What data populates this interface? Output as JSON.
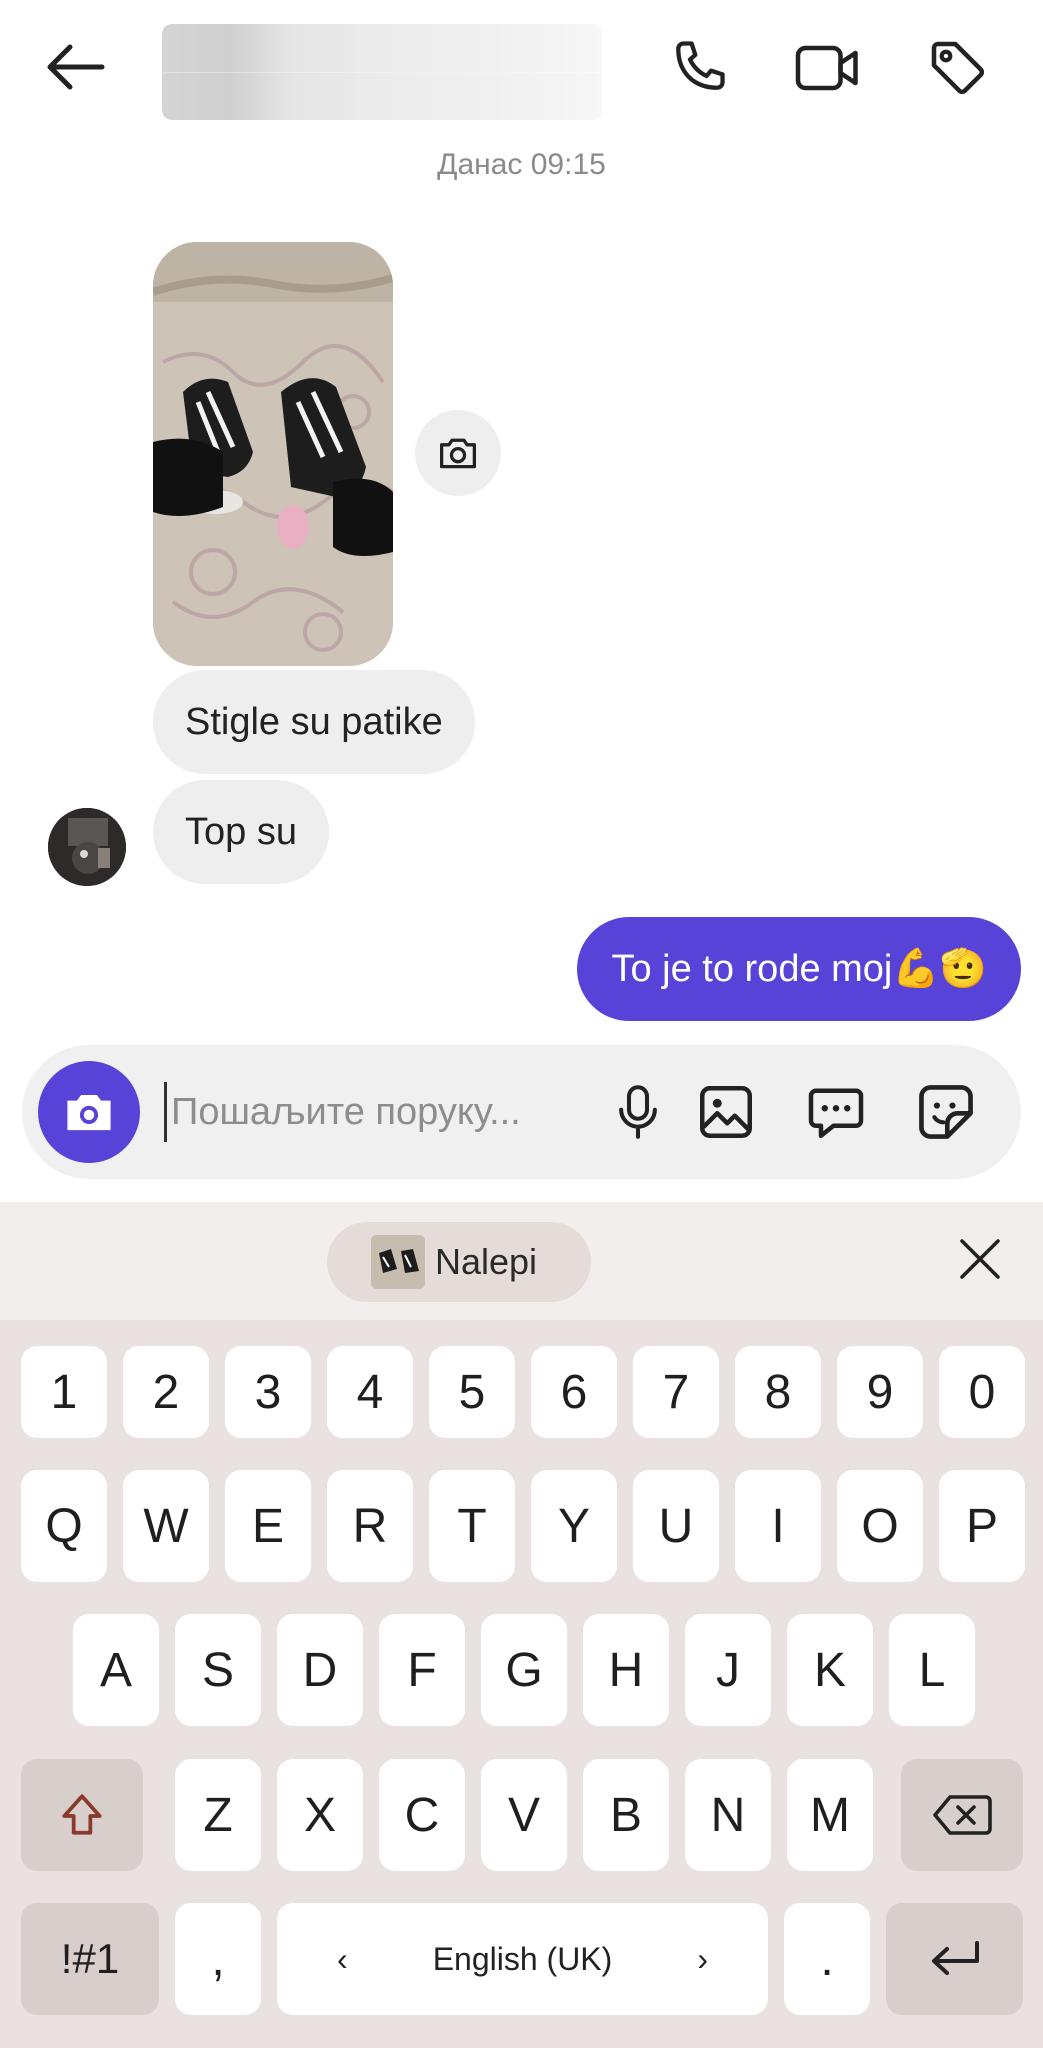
{
  "header": {
    "contact_name": "",
    "icons": [
      "arrow-back-icon",
      "phone-icon",
      "video-camera-icon",
      "tag-icon"
    ]
  },
  "conversation": {
    "date_label": "Данас 09:15",
    "incoming": [
      {
        "type": "photo",
        "description_icon": "sneakers-photo"
      },
      {
        "type": "text",
        "text": "Stigle su patike"
      },
      {
        "type": "text",
        "text": "Top su"
      }
    ],
    "outgoing": [
      {
        "type": "text",
        "text": "To je to rode moj💪🫡"
      }
    ]
  },
  "composer": {
    "placeholder": "Пошаљите поруку...",
    "value": "",
    "icons": [
      "camera-icon",
      "microphone-icon",
      "gallery-icon",
      "chat-dots-icon",
      "sticker-icon"
    ]
  },
  "keyboard": {
    "paste_label": "Nalepi",
    "number_row": [
      "1",
      "2",
      "3",
      "4",
      "5",
      "6",
      "7",
      "8",
      "9",
      "0"
    ],
    "row1": [
      "Q",
      "W",
      "E",
      "R",
      "T",
      "Y",
      "U",
      "I",
      "O",
      "P"
    ],
    "row2": [
      "A",
      "S",
      "D",
      "F",
      "G",
      "H",
      "J",
      "K",
      "L"
    ],
    "row3": [
      "Z",
      "X",
      "C",
      "V",
      "B",
      "N",
      "M"
    ],
    "symbols_label": "!#1",
    "comma_label": ",",
    "space_label": "English (UK)",
    "space_left": "‹",
    "space_right": "›",
    "period_label": ".",
    "colors": {
      "accent": "#5843d8",
      "keyboard_bg": "#e9e2e0",
      "key_bg": "#ffffff",
      "modifier_key_bg": "#d8cecb"
    }
  }
}
